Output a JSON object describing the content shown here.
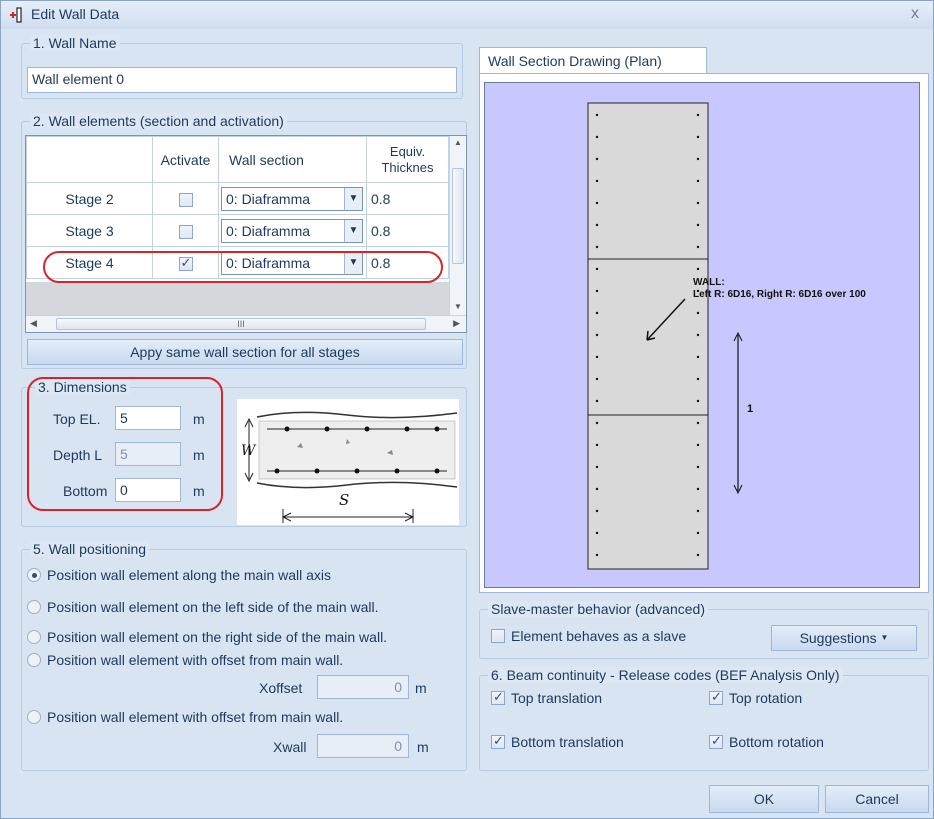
{
  "window": {
    "title": "Edit Wall Data",
    "close": "x"
  },
  "wall_name": {
    "group": "1. Wall Name",
    "value": "Wall element 0"
  },
  "elements": {
    "group": "2. Wall elements (section and activation)",
    "headers": {
      "activate": "Activate",
      "section": "Wall section",
      "thickness_line1": "Equiv.",
      "thickness_line2": "Thicknes"
    },
    "rows": [
      {
        "stage": "Stage 2",
        "active": false,
        "section": "0: Diaframma",
        "thickness": "0.8"
      },
      {
        "stage": "Stage 3",
        "active": false,
        "section": "0: Diaframma",
        "thickness": "0.8"
      },
      {
        "stage": "Stage 4",
        "active": true,
        "section": "0: Diaframma",
        "thickness": "0.8"
      }
    ],
    "apply_all": "Appy same wall section for all stages"
  },
  "dimensions": {
    "group": "3. Dimensions",
    "top_label": "Top EL.",
    "top_value": "5",
    "top_unit": "m",
    "depth_label": "Depth L",
    "depth_value": "5",
    "depth_unit": "m",
    "bottom_label": "Bottom",
    "bottom_value": "0",
    "bottom_unit": "m",
    "sketch_w": "W",
    "sketch_s": "S"
  },
  "positioning": {
    "group": "5. Wall positioning",
    "options": [
      "Position wall element along the main wall axis",
      "Position wall element on the left side of the main wall.",
      "Position wall element on the right side of the main wall.",
      "Position wall element with offset from main wall.",
      "Position wall element with offset from main wall."
    ],
    "selected_index": 0,
    "xoffset_label": "Xoffset",
    "xoffset_value": "0",
    "xoffset_unit": "m",
    "xwall_label": "Xwall",
    "xwall_value": "0",
    "xwall_unit": "m"
  },
  "drawing": {
    "tab": "Wall Section Drawing (Plan)",
    "wall_label": "WALL:",
    "reinf_label": "Left R: 6D16, Right R: 6D16 over 100",
    "dim_label": "1",
    "bg_color": "#c8c8ff"
  },
  "slave": {
    "group": "Slave-master behavior (advanced)",
    "checkbox": "Element behaves as a slave",
    "checked": false,
    "suggestions": "Suggestions"
  },
  "continuity": {
    "group": "6. Beam continuity - Release codes (BEF Analysis Only)",
    "top_translation": "Top translation",
    "top_rotation": "Top rotation",
    "bottom_translation": "Bottom translation",
    "bottom_rotation": "Bottom rotation"
  },
  "buttons": {
    "ok": "OK",
    "cancel": "Cancel"
  }
}
